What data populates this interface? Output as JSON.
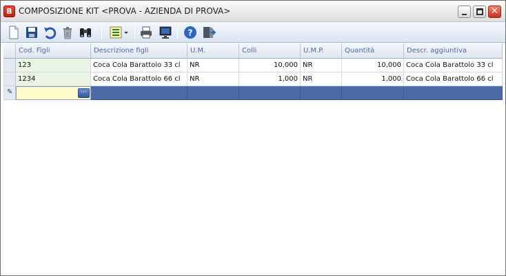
{
  "window": {
    "title": "COMPOSIZIONE KIT <PROVA - AZIENDA DI PROVA>",
    "app_icon_letter": "B"
  },
  "toolbar": {
    "buttons": [
      {
        "name": "new",
        "icon": "new-document-icon"
      },
      {
        "name": "save",
        "icon": "save-icon"
      },
      {
        "name": "undo",
        "icon": "undo-icon"
      },
      {
        "name": "delete",
        "icon": "trash-icon"
      },
      {
        "name": "find",
        "icon": "binoculars-icon"
      },
      {
        "name": "view-options",
        "icon": "list-dropdown-icon"
      },
      {
        "name": "print",
        "icon": "printer-icon"
      },
      {
        "name": "preview",
        "icon": "monitor-icon"
      },
      {
        "name": "help",
        "icon": "help-icon"
      },
      {
        "name": "exit",
        "icon": "exit-door-icon"
      }
    ]
  },
  "grid": {
    "columns": [
      "Cod. Figli",
      "Descrizione figli",
      "U.M.",
      "Colli",
      "U.M.P.",
      "Quantità",
      "Descr. aggiuntiva"
    ],
    "rows": [
      [
        "123",
        "Coca Cola Barattolo 33 cl",
        "NR",
        "10,000",
        "NR",
        "10,000",
        "Coca Cola Barattolo 33 cl"
      ],
      [
        "1234",
        "Coca Cola Barattolo 66 cl",
        "NR",
        "1,000",
        "NR",
        "1,000",
        "Coca Cola Barattolo 66 cl"
      ]
    ],
    "new_row_editor_button": "···"
  },
  "colors": {
    "header_text": "#4c66a0",
    "selected_row": "#4a6ba8",
    "edit_cell": "#fffbcc",
    "code_cell": "#eaf4e3"
  }
}
